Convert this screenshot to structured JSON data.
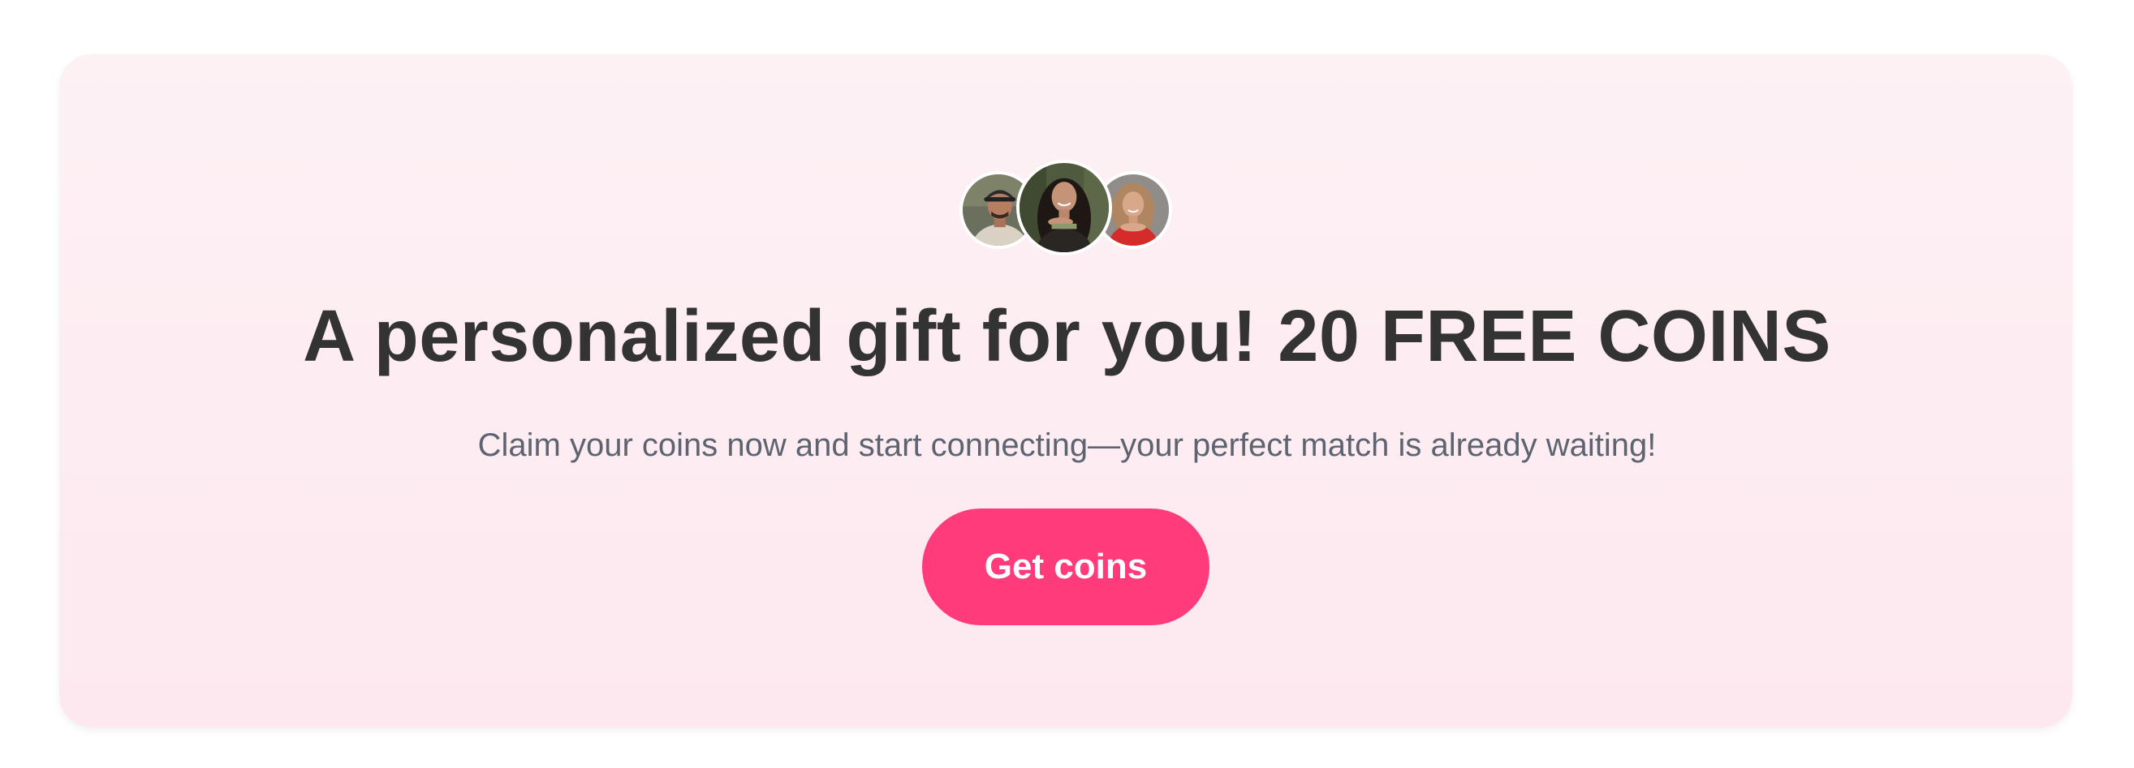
{
  "promo": {
    "headline": "A personalized gift for you! 20 FREE COINS",
    "subline": "Claim your coins now and start connecting—your perfect match is already waiting!",
    "cta_label": "Get coins"
  },
  "avatars": [
    {
      "name": "profile-photo-man-cap"
    },
    {
      "name": "profile-photo-woman-dark-hair"
    },
    {
      "name": "profile-photo-woman-blonde"
    }
  ],
  "colors": {
    "banner_bg_top": "#fdf1f4",
    "banner_bg_bottom": "#fde8f0",
    "headline": "#333333",
    "subline": "#5d6470",
    "cta_bg": "#ff3b7b",
    "cta_text": "#ffffff"
  }
}
